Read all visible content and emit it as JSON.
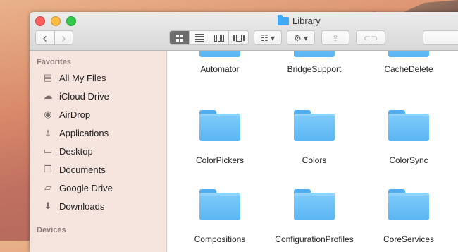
{
  "window": {
    "title": "Library"
  },
  "toolbar": {
    "back": "‹",
    "forward": "›",
    "arrange": "☷ ▾",
    "action": "⚙ ▾",
    "share": "⇪",
    "tags": "⊂⊃"
  },
  "sidebar": {
    "favorites_header": "Favorites",
    "devices_header": "Devices",
    "items": [
      {
        "label": "All My Files",
        "icon": "all-files-icon"
      },
      {
        "label": "iCloud Drive",
        "icon": "cloud-icon"
      },
      {
        "label": "AirDrop",
        "icon": "airdrop-icon"
      },
      {
        "label": "Applications",
        "icon": "applications-icon"
      },
      {
        "label": "Desktop",
        "icon": "desktop-icon"
      },
      {
        "label": "Documents",
        "icon": "documents-icon"
      },
      {
        "label": "Google Drive",
        "icon": "folder-icon"
      },
      {
        "label": "Downloads",
        "icon": "downloads-icon"
      }
    ]
  },
  "content": {
    "items": [
      {
        "name": "Automator"
      },
      {
        "name": "BridgeSupport"
      },
      {
        "name": "CacheDelete"
      },
      {
        "name": "ColorPickers"
      },
      {
        "name": "Colors"
      },
      {
        "name": "ColorSync"
      },
      {
        "name": "Compositions"
      },
      {
        "name": "ConfigurationProfiles"
      },
      {
        "name": "CoreServices"
      }
    ]
  },
  "colors": {
    "folder": "#5bb6f3",
    "sidebar_bg": "#f5e2dc",
    "close": "#fc605c",
    "minimize": "#fdbc40",
    "maximize": "#34c84a"
  }
}
